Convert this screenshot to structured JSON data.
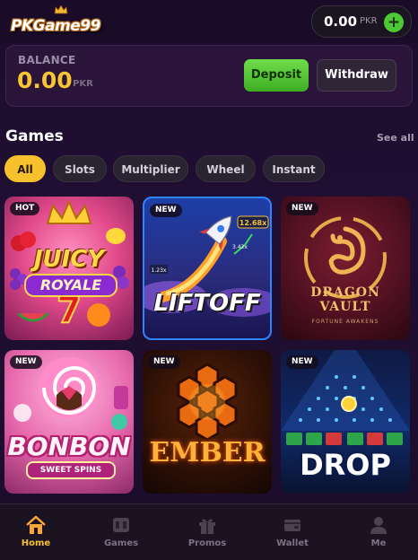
{
  "header": {
    "logo_text": "PKGame99",
    "wallet": {
      "amount": "0.00",
      "currency": "PKR",
      "add_symbol": "+"
    }
  },
  "balance": {
    "label": "BALANCE",
    "amount": "0.00",
    "currency": "PKR",
    "deposit_label": "Deposit",
    "withdraw_label": "Withdraw"
  },
  "games_section": {
    "title": "Games",
    "see_all": "See all",
    "filters": [
      {
        "label": "All",
        "active": true
      },
      {
        "label": "Slots",
        "active": false
      },
      {
        "label": "Multiplier",
        "active": false
      },
      {
        "label": "Wheel",
        "active": false
      },
      {
        "label": "Instant",
        "active": false
      }
    ],
    "games": [
      {
        "badge": "HOT",
        "title_line1": "JUICY",
        "title_line2": "ROYALE",
        "title_line3": "7",
        "art": "fruit-slot-art"
      },
      {
        "badge": "NEW",
        "title": "LIFTOFF",
        "multipliers": [
          "12.68x",
          "3.42x",
          "1.23x"
        ],
        "art": "rocket-art"
      },
      {
        "badge": "NEW",
        "title_line1": "DRAGON",
        "title_line2": "VAULT",
        "subtitle": "FORTUNE AWAKENS",
        "art": "dragon-emblem-art"
      },
      {
        "badge": "NEW",
        "title": "BONBON",
        "subtitle": "SWEET SPINS",
        "art": "candy-art"
      },
      {
        "badge": "NEW",
        "title": "EMBER",
        "art": "hexagon-lava-art"
      },
      {
        "badge": "NEW",
        "title": "DROP",
        "art": "plinko-art"
      }
    ]
  },
  "bottom_nav": [
    {
      "label": "Home",
      "icon": "home-icon",
      "active": true
    },
    {
      "label": "Games",
      "icon": "games-icon",
      "active": false
    },
    {
      "label": "Promos",
      "icon": "gift-icon",
      "active": false
    },
    {
      "label": "Wallet",
      "icon": "wallet-icon",
      "active": false
    },
    {
      "label": "Me",
      "icon": "user-icon",
      "active": false
    }
  ],
  "colors": {
    "accent_yellow": "#f7c02d",
    "deposit_green": "#4cc934",
    "background": "#1d0d2c"
  }
}
